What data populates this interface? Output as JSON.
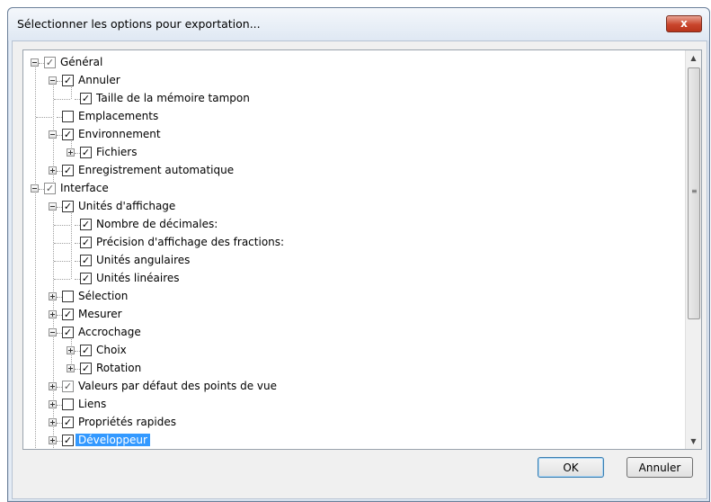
{
  "dialog": {
    "title": "Sélectionner les options pour exportation...",
    "close_glyph": "x",
    "ok_label": "OK",
    "cancel_label": "Annuler"
  },
  "tree": {
    "items": [
      {
        "label": "Général",
        "checked": true,
        "expander": "minus"
      },
      {
        "label": "Annuler",
        "checked": true,
        "expander": "minus"
      },
      {
        "label": "Taille de la mémoire tampon",
        "checked": true,
        "expander": null
      },
      {
        "label": "Emplacements",
        "checked": false,
        "expander": null
      },
      {
        "label": "Environnement",
        "checked": true,
        "expander": "minus"
      },
      {
        "label": "Fichiers",
        "checked": true,
        "expander": "plus"
      },
      {
        "label": "Enregistrement automatique",
        "checked": true,
        "expander": "plus"
      },
      {
        "label": "Interface",
        "checked": true,
        "expander": "minus"
      },
      {
        "label": "Unités d'affichage",
        "checked": true,
        "expander": "minus"
      },
      {
        "label": "Nombre de décimales:",
        "checked": true,
        "expander": null
      },
      {
        "label": "Précision d'affichage des fractions:",
        "checked": true,
        "expander": null
      },
      {
        "label": "Unités angulaires",
        "checked": true,
        "expander": null
      },
      {
        "label": "Unités linéaires",
        "checked": true,
        "expander": null
      },
      {
        "label": "Sélection",
        "checked": false,
        "expander": "plus"
      },
      {
        "label": "Mesurer",
        "checked": true,
        "expander": "plus"
      },
      {
        "label": "Accrochage",
        "checked": true,
        "expander": "minus"
      },
      {
        "label": "Choix",
        "checked": true,
        "expander": "plus"
      },
      {
        "label": "Rotation",
        "checked": true,
        "expander": "plus"
      },
      {
        "label": "Valeurs par défaut des points de vue",
        "checked": true,
        "expander": "plus"
      },
      {
        "label": "Liens",
        "checked": false,
        "expander": "plus"
      },
      {
        "label": "Propriétés rapides",
        "checked": true,
        "expander": "plus"
      },
      {
        "label": "Développeur",
        "checked": true,
        "expander": "plus",
        "selected": true
      }
    ]
  },
  "icons": {
    "check": "✓",
    "scroll_up": "▲",
    "scroll_down": "▼",
    "grip": "≡"
  }
}
